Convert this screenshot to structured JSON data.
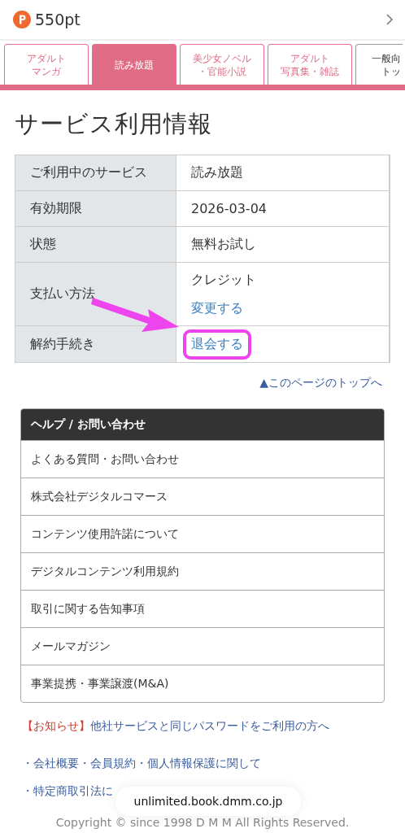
{
  "points": "550pt",
  "tabs": [
    {
      "label_lines": [
        "アダルト",
        "マンガ"
      ],
      "selected": false,
      "kind": "pink"
    },
    {
      "label_lines": [
        "読み放題"
      ],
      "selected": true,
      "kind": "pink"
    },
    {
      "label_lines": [
        "美少女ノベル",
        "・官能小説"
      ],
      "selected": false,
      "kind": "pink"
    },
    {
      "label_lines": [
        "アダルト",
        "写真集・雑誌"
      ],
      "selected": false,
      "kind": "pink"
    },
    {
      "label_lines": [
        "一般向",
        "トッ"
      ],
      "selected": false,
      "kind": "grey"
    }
  ],
  "title": "サービス利用情報",
  "info_rows": [
    {
      "label": "ご利用中のサービス",
      "value": "読み放題"
    },
    {
      "label": "有効期限",
      "value": "2026-03-04"
    },
    {
      "label": "状態",
      "value": "無料お試し"
    },
    {
      "label": "支払い方法",
      "value": "クレジット",
      "link": "変更する"
    },
    {
      "label": "解約手続き",
      "link": "退会する",
      "highlighted": true
    }
  ],
  "page_top_link": "▲このページのトップへ",
  "help": {
    "title": "ヘルプ / お問い合わせ",
    "items": [
      "よくある質問・お問い合わせ",
      "株式会社デジタルコマース",
      "コンテンツ使用許諾について",
      "デジタルコンテンツ利用規約",
      "取引に関する告知事項",
      "メールマガジン",
      "事業提携・事業譲渡(M&A)"
    ]
  },
  "notice": {
    "tag": "【お知らせ】",
    "text": "他社サービスと同じパスワードをご利用の方へ"
  },
  "footer_links": [
    "・会社概要・会員規約・個人情報保護に関して",
    "・特定商取引法に"
  ],
  "url_pill": "unlimited.book.dmm.co.jp",
  "copyright": "Copyright © since 1998 D M M All Rights Reserved."
}
